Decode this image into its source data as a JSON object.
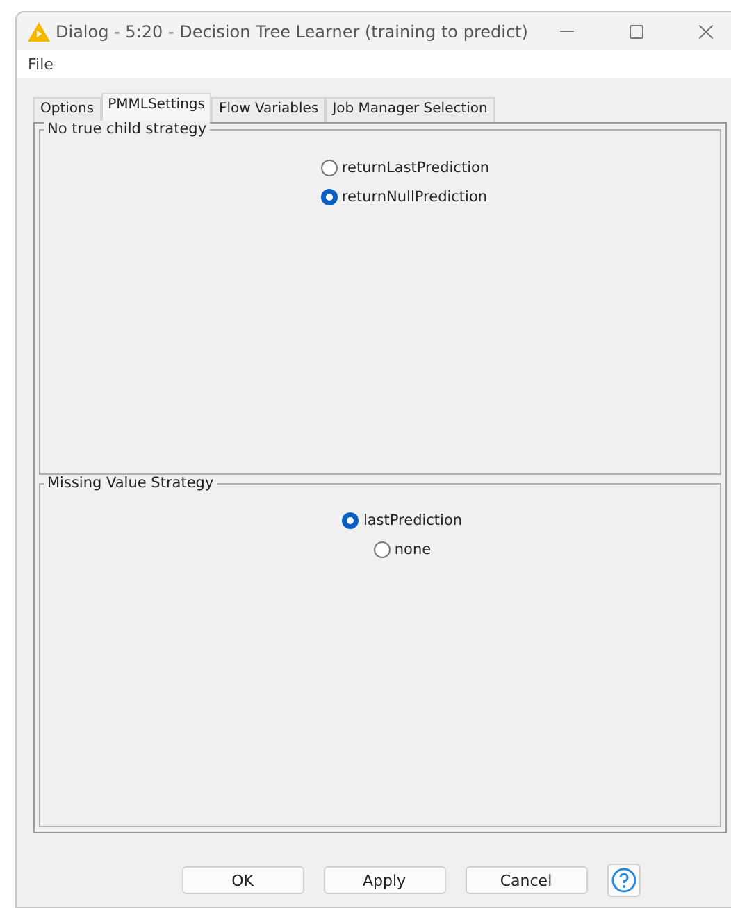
{
  "window": {
    "title": "Dialog - 5:20 - Decision Tree Learner (training to predict)"
  },
  "menu": [
    "File"
  ],
  "tabs": [
    {
      "label": "Options",
      "selected": false
    },
    {
      "label": "PMMLSettings",
      "selected": true
    },
    {
      "label": "Flow Variables",
      "selected": false
    },
    {
      "label": "Job Manager Selection",
      "selected": false
    }
  ],
  "groups": [
    {
      "title": "No true child strategy",
      "options": [
        {
          "label": "returnLastPrediction",
          "selected": false
        },
        {
          "label": "returnNullPrediction",
          "selected": true
        }
      ]
    },
    {
      "title": "Missing Value Strategy",
      "options": [
        {
          "label": "lastPrediction",
          "selected": true
        },
        {
          "label": "none",
          "selected": false
        }
      ]
    }
  ],
  "buttons": [
    "OK",
    "Apply",
    "Cancel"
  ]
}
